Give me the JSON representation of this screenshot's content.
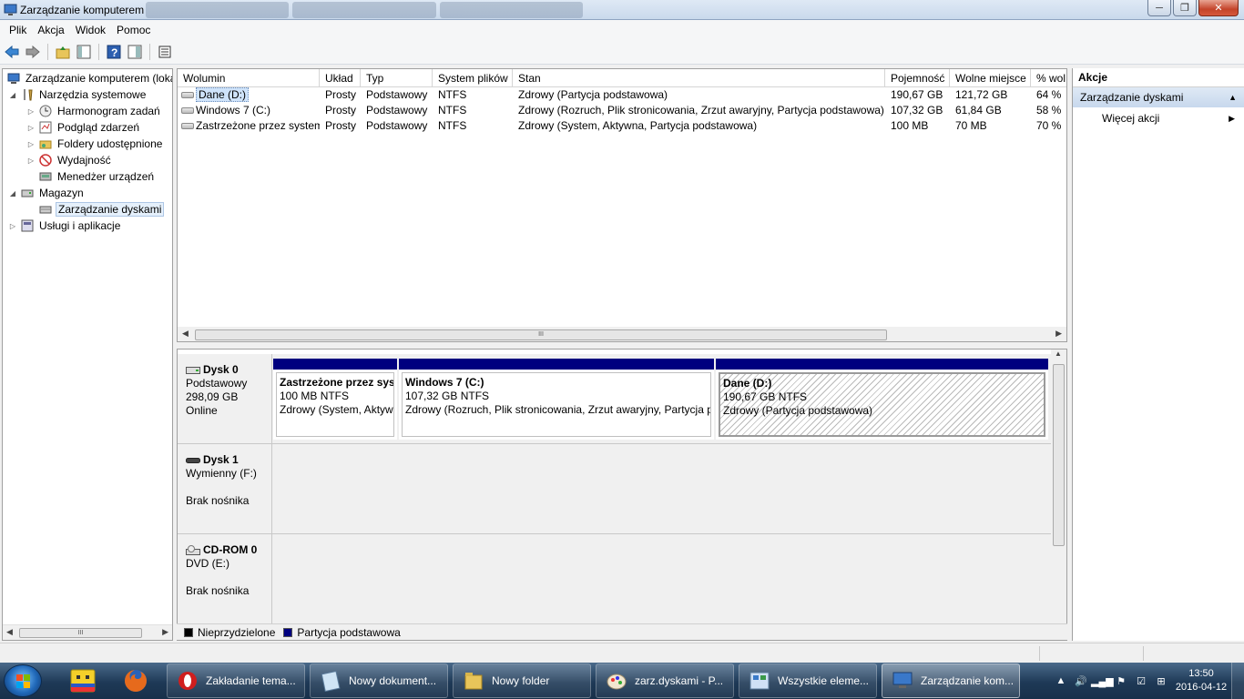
{
  "window": {
    "title": "Zarządzanie komputerem",
    "controls": {
      "minimize": "─",
      "maximize": "❐",
      "close": "✕"
    }
  },
  "menu": [
    "Plik",
    "Akcja",
    "Widok",
    "Pomoc"
  ],
  "tree": {
    "items": [
      {
        "label": "Zarządzanie komputerem (loka",
        "level": 0,
        "expander": "",
        "icon": "computer-management-icon"
      },
      {
        "label": "Narzędzia systemowe",
        "level": 1,
        "expander": "◢",
        "icon": "tools-icon"
      },
      {
        "label": "Harmonogram zadań",
        "level": 2,
        "expander": "▷",
        "icon": "clock-icon"
      },
      {
        "label": "Podgląd zdarzeń",
        "level": 2,
        "expander": "▷",
        "icon": "event-viewer-icon"
      },
      {
        "label": "Foldery udostępnione",
        "level": 2,
        "expander": "▷",
        "icon": "shared-folder-icon"
      },
      {
        "label": "Wydajność",
        "level": 2,
        "expander": "▷",
        "icon": "performance-icon"
      },
      {
        "label": "Menedżer urządzeń",
        "level": 2,
        "expander": "",
        "icon": "device-manager-icon"
      },
      {
        "label": "Magazyn",
        "level": 1,
        "expander": "◢",
        "icon": "storage-icon"
      },
      {
        "label": "Zarządzanie dyskami",
        "level": 2,
        "expander": "",
        "icon": "disk-management-icon",
        "selected": true
      },
      {
        "label": "Usługi i aplikacje",
        "level": 1,
        "expander": "▷",
        "icon": "services-icon"
      }
    ]
  },
  "volumes": {
    "columns": [
      "Wolumin",
      "Układ",
      "Typ",
      "System plików",
      "Stan",
      "Pojemność",
      "Wolne miejsce",
      "% wol"
    ],
    "rows": [
      {
        "name": "Dane (D:)",
        "layout": "Prosty",
        "type": "Podstawowy",
        "fs": "NTFS",
        "status": "Zdrowy (Partycja podstawowa)",
        "capacity": "190,67 GB",
        "free": "121,72 GB",
        "pct": "64 %",
        "selected": true
      },
      {
        "name": "Windows 7 (C:)",
        "layout": "Prosty",
        "type": "Podstawowy",
        "fs": "NTFS",
        "status": "Zdrowy (Rozruch, Plik stronicowania, Zrzut awaryjny, Partycja podstawowa)",
        "capacity": "107,32 GB",
        "free": "61,84 GB",
        "pct": "58 %"
      },
      {
        "name": "Zastrzeżone przez system",
        "layout": "Prosty",
        "type": "Podstawowy",
        "fs": "NTFS",
        "status": "Zdrowy (System, Aktywna, Partycja podstawowa)",
        "capacity": "100 MB",
        "free": "70 MB",
        "pct": "70 %"
      }
    ],
    "scroll_grip": "III"
  },
  "disks": [
    {
      "name": "Dysk 0",
      "line1": "Podstawowy",
      "line2": "298,09 GB",
      "line3": "Online",
      "partitions": [
        {
          "title": "Zastrzeżone przez sys",
          "size": "100 MB NTFS",
          "status": "Zdrowy (System, Aktyw"
        },
        {
          "title": "Windows 7  (C:)",
          "size": "107,32 GB NTFS",
          "status": "Zdrowy (Rozruch, Plik stronicowania, Zrzut awaryjny, Partycja p"
        },
        {
          "title": "Dane  (D:)",
          "size": "190,67 GB NTFS",
          "status": "Zdrowy (Partycja podstawowa)"
        }
      ]
    },
    {
      "name": "Dysk 1",
      "line1": "Wymienny (F:)",
      "line2": "",
      "line3": "Brak nośnika"
    },
    {
      "name": "CD-ROM 0",
      "line1": "DVD (E:)",
      "line2": "",
      "line3": "Brak nośnika"
    }
  ],
  "legend": [
    {
      "label": "Nieprzydzielone",
      "color": "#000000"
    },
    {
      "label": "Partycja podstawowa",
      "color": "#00007f"
    }
  ],
  "actions": {
    "header": "Akcje",
    "section": "Zarządzanie dyskami",
    "items": [
      "Więcej akcji"
    ]
  },
  "taskbar": {
    "tasks": [
      {
        "label": "Zakładanie tema...",
        "icon": "opera-icon"
      },
      {
        "label": "Nowy dokument...",
        "icon": "notepad-icon"
      },
      {
        "label": "Nowy folder",
        "icon": "folder-icon"
      },
      {
        "label": "zarz.dyskami - P...",
        "icon": "paint-icon"
      },
      {
        "label": "Wszystkie eleme...",
        "icon": "control-panel-icon"
      },
      {
        "label": "Zarządzanie kom...",
        "icon": "computer-management-icon",
        "active": true
      }
    ],
    "time": "13:50",
    "date": "2016-04-12"
  },
  "colors": {
    "primary_partition": "#00007f",
    "selection": "#cfe3fa",
    "taskbar": "#1e3956"
  }
}
